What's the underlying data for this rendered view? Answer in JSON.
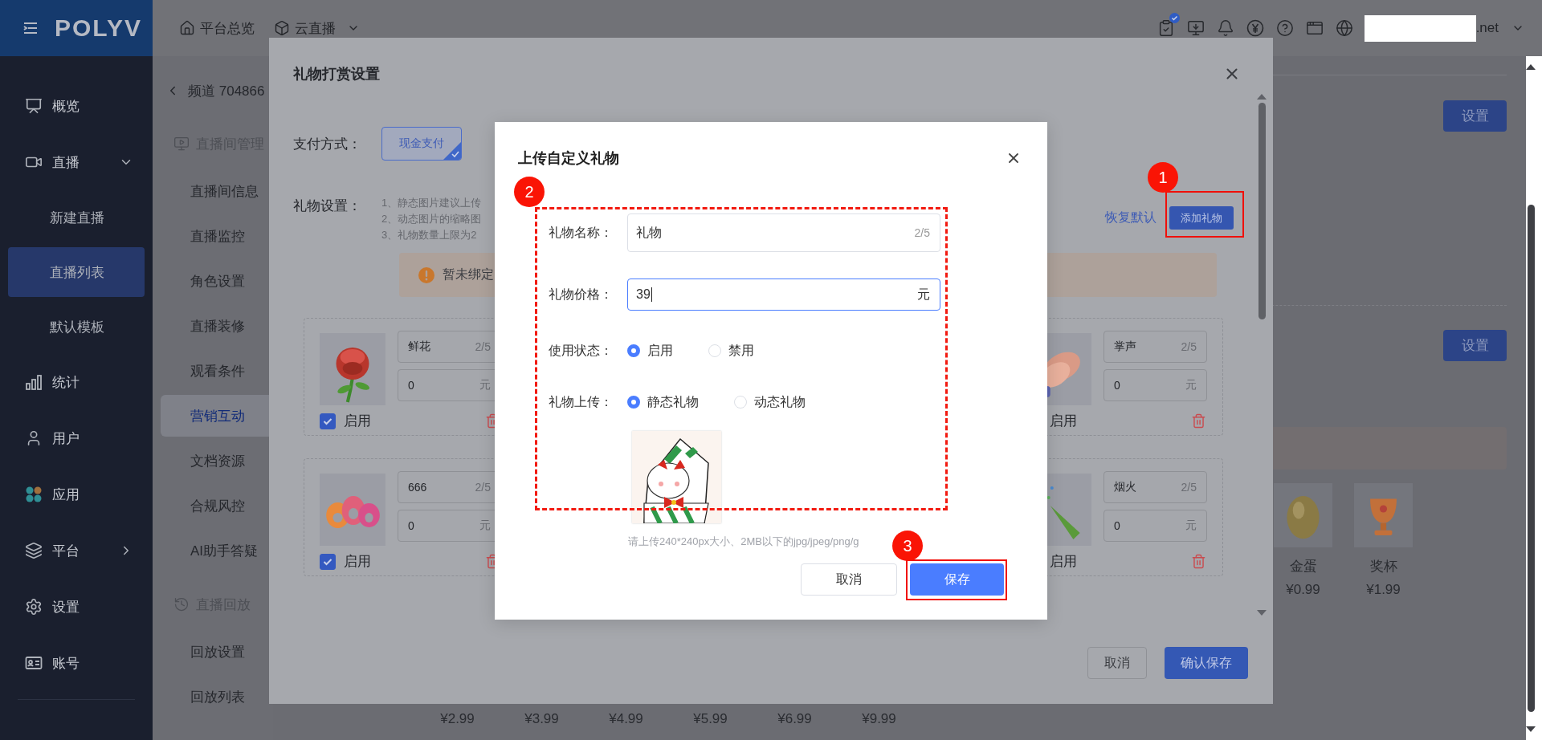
{
  "sidebar": {
    "logo": "POLYV",
    "items": [
      {
        "label": "概览",
        "kind": "main",
        "selected": false
      },
      {
        "label": "直播",
        "kind": "main",
        "selected": false,
        "expanded": true
      },
      {
        "label": "新建直播",
        "kind": "sub",
        "selected": false
      },
      {
        "label": "直播列表",
        "kind": "sub",
        "selected": true
      },
      {
        "label": "默认模板",
        "kind": "sub",
        "selected": false
      },
      {
        "label": "统计",
        "kind": "main",
        "selected": false
      },
      {
        "label": "用户",
        "kind": "main",
        "selected": false
      },
      {
        "label": "应用",
        "kind": "main",
        "selected": false
      },
      {
        "label": "平台",
        "kind": "main",
        "selected": false,
        "expanded": false
      },
      {
        "label": "设置",
        "kind": "main",
        "selected": false
      },
      {
        "label": "账号",
        "kind": "main",
        "selected": false
      }
    ]
  },
  "topbar": {
    "nav": [
      {
        "label": "平台总览",
        "dropdown": false
      },
      {
        "label": "云直播",
        "dropdown": true
      }
    ],
    "task_badge": true,
    "account_suffix": ".net"
  },
  "subnav": {
    "back": "频道 704866",
    "items": [
      {
        "label": "直播间管理",
        "kind": "group",
        "selected": false
      },
      {
        "label": "直播间信息",
        "kind": "link",
        "selected": false
      },
      {
        "label": "直播监控",
        "kind": "link",
        "selected": false
      },
      {
        "label": "角色设置",
        "kind": "link",
        "selected": false
      },
      {
        "label": "直播装修",
        "kind": "link",
        "selected": false
      },
      {
        "label": "观看条件",
        "kind": "link",
        "selected": false
      },
      {
        "label": "营销互动",
        "kind": "link",
        "selected": true
      },
      {
        "label": "文档资源",
        "kind": "link",
        "selected": false
      },
      {
        "label": "合规风控",
        "kind": "link",
        "selected": false
      },
      {
        "label": "AI助手答疑",
        "kind": "link",
        "selected": false
      },
      {
        "label": "直播回放",
        "kind": "group",
        "selected": false
      },
      {
        "label": "回放设置",
        "kind": "link",
        "selected": false
      },
      {
        "label": "回放列表",
        "kind": "link",
        "selected": false
      }
    ]
  },
  "background": {
    "settings_buttons": [
      "设置",
      "设置"
    ],
    "gifts": [
      {
        "name": "金蛋",
        "price": "¥0.99"
      },
      {
        "name": "奖杯",
        "price": "¥1.99"
      }
    ],
    "prices": [
      "¥2.99",
      "¥3.99",
      "¥4.99",
      "¥5.99",
      "¥6.99",
      "¥9.99"
    ]
  },
  "gift_dialog": {
    "title": "礼物打赏设置",
    "payment": {
      "label": "支付方式：",
      "options": [
        {
          "label": "现金支付",
          "selected": true
        }
      ]
    },
    "settings_label": "礼物设置：",
    "notes": [
      "1、静态图片建议上传",
      "2、动态图片的缩略图",
      "3、礼物数量上限为2"
    ],
    "restore": "恢复默认",
    "add": "添加礼物",
    "warning": "暂未绑定",
    "cards": [
      [
        {
          "name": "鲜花",
          "count": "2/5",
          "price": "0",
          "unit": "元",
          "enabled": true,
          "enable_label": "启用"
        },
        {
          "name": "掌声",
          "count": "2/5",
          "price": "0",
          "unit": "元",
          "enable_label": "启用"
        }
      ],
      [
        {
          "name": "666",
          "count": "2/5",
          "price": "0",
          "unit": "元",
          "enabled": true,
          "enable_label": "启用"
        },
        {
          "name": "烟火",
          "count": "2/5",
          "price": "0",
          "unit": "元",
          "enable_label": "启用"
        }
      ]
    ],
    "footer": {
      "cancel": "取消",
      "confirm": "确认保存"
    }
  },
  "upload_dialog": {
    "title": "上传自定义礼物",
    "fields": [
      {
        "kind": "text",
        "label": "礼物名称：",
        "value": "礼物",
        "counter": "2/5",
        "focused": false
      },
      {
        "kind": "text",
        "label": "礼物价格：",
        "value": "39",
        "suffix": "元",
        "focused": true
      },
      {
        "kind": "radio",
        "label": "使用状态：",
        "options": [
          {
            "label": "启用",
            "selected": true
          },
          {
            "label": "禁用",
            "selected": false
          }
        ]
      },
      {
        "kind": "radio",
        "label": "礼物上传：",
        "options": [
          {
            "label": "静态礼物",
            "selected": true
          },
          {
            "label": "动态礼物",
            "selected": false
          }
        ]
      }
    ],
    "hint": "请上传240*240px大小、2MB以下的jpg/jpeg/png/g",
    "buttons": {
      "cancel": "取消",
      "save": "保存"
    }
  },
  "annotations": [
    {
      "number": "1"
    },
    {
      "number": "2"
    },
    {
      "number": "3"
    }
  ]
}
